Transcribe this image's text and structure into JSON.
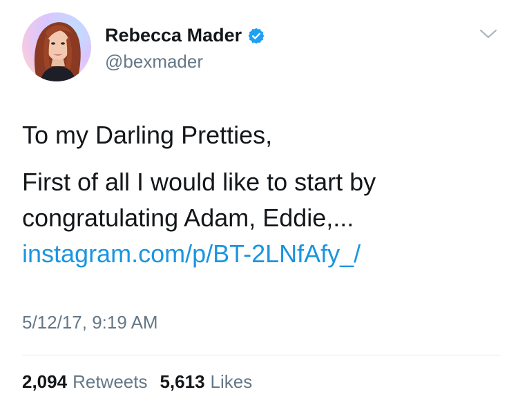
{
  "tweet": {
    "author": {
      "display_name": "Rebecca Mader",
      "handle": "@bexmader",
      "verified": true,
      "avatar_icon": "profile-photo",
      "verified_icon": "verified-badge-icon"
    },
    "menu_icon": "chevron-down-icon",
    "text": {
      "greeting": "To my Darling Pretties,",
      "line": "First of all I would like to start by congratulating Adam, Eddie,...",
      "link": "instagram.com/p/BT-2LNfAfy_/"
    },
    "timestamp": "5/12/17, 9:19 AM",
    "stats": {
      "retweets_count": "2,094",
      "retweets_label": "Retweets",
      "likes_count": "5,613",
      "likes_label": "Likes"
    }
  },
  "colors": {
    "link": "#1b95e0",
    "secondary_text": "#657786",
    "primary_text": "#14171a",
    "verified": "#1da1f2",
    "divider": "#e1e8ed"
  }
}
